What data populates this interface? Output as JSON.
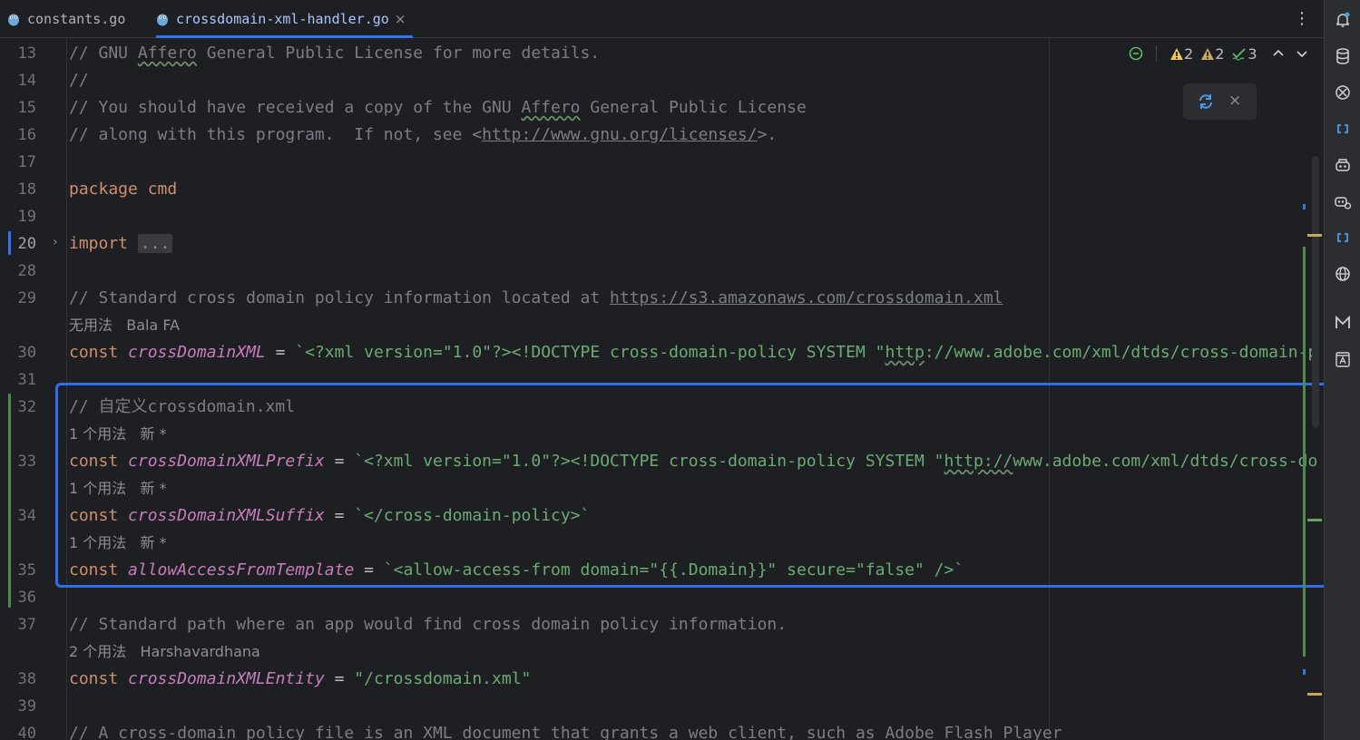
{
  "tabs": [
    {
      "label": "constants.go",
      "active": false
    },
    {
      "label": "crossdomain-xml-handler.go",
      "active": true
    }
  ],
  "tab_close_glyph": "×",
  "more_menu_glyph": "⋮",
  "inspection": {
    "warnings": "2",
    "weak_warnings": "2",
    "typos": "3"
  },
  "reload_popup": {
    "close_glyph": "×"
  },
  "lines": [
    {
      "num": "13",
      "spans": [
        {
          "t": "// GNU ",
          "c": "cm"
        },
        {
          "t": "Affero",
          "c": "cm wavy"
        },
        {
          "t": " General Public License for more details.",
          "c": "cm"
        }
      ]
    },
    {
      "num": "14",
      "spans": [
        {
          "t": "//",
          "c": "cm"
        }
      ]
    },
    {
      "num": "15",
      "spans": [
        {
          "t": "// You should have received a copy of the GNU ",
          "c": "cm"
        },
        {
          "t": "Affero",
          "c": "cm wavy"
        },
        {
          "t": " General Public License",
          "c": "cm"
        }
      ]
    },
    {
      "num": "16",
      "spans": [
        {
          "t": "// along with this program.  If not, see <",
          "c": "cm"
        },
        {
          "t": "http://www.gnu.org/licenses/",
          "c": "cm ul"
        },
        {
          "t": ">.",
          "c": "cm"
        }
      ]
    },
    {
      "num": "17",
      "spans": []
    },
    {
      "num": "18",
      "spans": [
        {
          "t": "package ",
          "c": "kw"
        },
        {
          "t": "cmd",
          "c": "kw"
        }
      ]
    },
    {
      "num": "19",
      "spans": []
    },
    {
      "num": "20",
      "spans": [
        {
          "t": "import ",
          "c": "kw"
        },
        {
          "t": "...",
          "c": "fold"
        }
      ]
    },
    {
      "num": "28",
      "spans": []
    },
    {
      "num": "29",
      "spans": [
        {
          "t": "// Standard cross domain policy information located at ",
          "c": "cm"
        },
        {
          "t": "https://s3.amazonaws.com/crossdomain.xml",
          "c": "cm ul"
        }
      ]
    },
    {
      "num": "",
      "hint": "无用法   Bala FA",
      "spans": []
    },
    {
      "num": "30",
      "spans": [
        {
          "t": "const ",
          "c": "kw"
        },
        {
          "t": "crossDomainXML",
          "c": "cn"
        },
        {
          "t": " = ",
          "c": "pl"
        },
        {
          "t": "`<?xml version=\"1.0\"?><!DOCTYPE cross-domain-policy SYSTEM \"",
          "c": "str"
        },
        {
          "t": "http",
          "c": "str wavy"
        },
        {
          "t": "://www.adobe.com/xml/dtds/cross-domain-p",
          "c": "str"
        }
      ]
    },
    {
      "num": "31",
      "spans": []
    },
    {
      "num": "32",
      "spans": [
        {
          "t": "// 自定义crossdomain.xml",
          "c": "cm"
        }
      ]
    },
    {
      "num": "",
      "hint": "1 个用法   新 *",
      "spans": []
    },
    {
      "num": "33",
      "spans": [
        {
          "t": "const ",
          "c": "kw"
        },
        {
          "t": "crossDomainXMLPrefix",
          "c": "cn"
        },
        {
          "t": " = ",
          "c": "pl"
        },
        {
          "t": "`<?xml version=\"1.0\"?><!DOCTYPE cross-domain-policy SYSTEM \"",
          "c": "str"
        },
        {
          "t": "http://",
          "c": "str wavy"
        },
        {
          "t": "www.adobe.com/xml/dtds/cross-do",
          "c": "str"
        }
      ]
    },
    {
      "num": "",
      "hint": "1 个用法   新 *",
      "spans": []
    },
    {
      "num": "34",
      "spans": [
        {
          "t": "const ",
          "c": "kw"
        },
        {
          "t": "crossDomainXMLSuffix",
          "c": "cn"
        },
        {
          "t": " = ",
          "c": "pl"
        },
        {
          "t": "`</cross-domain-policy>`",
          "c": "str"
        }
      ]
    },
    {
      "num": "",
      "hint": "1 个用法   新 *",
      "spans": []
    },
    {
      "num": "35",
      "spans": [
        {
          "t": "const ",
          "c": "kw"
        },
        {
          "t": "allowAccessFromTemplate",
          "c": "cn"
        },
        {
          "t": " = ",
          "c": "pl"
        },
        {
          "t": "`<allow-access-from domain=\"{{.Domain}}\" secure=\"false\" />`",
          "c": "str"
        }
      ]
    },
    {
      "num": "36",
      "spans": []
    },
    {
      "num": "37",
      "spans": [
        {
          "t": "// Standard path where an app would find cross domain policy information.",
          "c": "cm"
        }
      ]
    },
    {
      "num": "",
      "hint": "2 个用法   Harshavardhana",
      "spans": []
    },
    {
      "num": "38",
      "spans": [
        {
          "t": "const ",
          "c": "kw"
        },
        {
          "t": "crossDomainXMLEntity",
          "c": "cn"
        },
        {
          "t": " = ",
          "c": "pl"
        },
        {
          "t": "\"/crossdomain.xml\"",
          "c": "str"
        }
      ]
    },
    {
      "num": "39",
      "spans": []
    },
    {
      "num": "40",
      "spans": [
        {
          "t": "// A cross-domain policy file is an XML document that grants a web client, such as Adobe Flash Player",
          "c": "cm"
        }
      ]
    }
  ]
}
